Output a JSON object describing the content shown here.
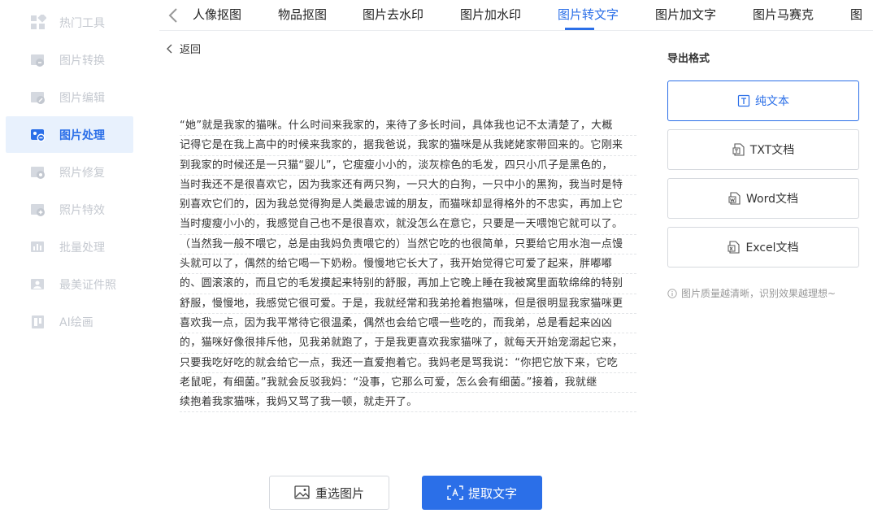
{
  "sidebar": {
    "items": [
      {
        "label": "热门工具",
        "icon": "grid-icon"
      },
      {
        "label": "图片转换",
        "icon": "image-convert-icon"
      },
      {
        "label": "图片编辑",
        "icon": "image-edit-icon"
      },
      {
        "label": "图片处理",
        "icon": "image-process-icon",
        "active": true
      },
      {
        "label": "照片修复",
        "icon": "photo-repair-icon"
      },
      {
        "label": "照片特效",
        "icon": "photo-effect-icon"
      },
      {
        "label": "批量处理",
        "icon": "batch-icon"
      },
      {
        "label": "最美证件照",
        "icon": "id-photo-icon"
      },
      {
        "label": "AI绘画",
        "icon": "ai-paint-icon"
      }
    ]
  },
  "tabs": [
    {
      "label": "人像抠图"
    },
    {
      "label": "物品抠图"
    },
    {
      "label": "图片去水印"
    },
    {
      "label": "图片加水印"
    },
    {
      "label": "图片转文字",
      "active": true
    },
    {
      "label": "图片加文字"
    },
    {
      "label": "图片马赛克"
    },
    {
      "label": "图"
    }
  ],
  "back_label": "返回",
  "text_lines": [
    "“她”就是我家的猫咪。什么时间来我家的，来待了多长时间，具体我也记不太清楚了，大概",
    "记得它是在我上高中的时候来我家的，据我爸说，我家的猫咪是从我姥姥家带回来的。它刚来",
    "到我家的时候还是一只猫“婴儿”，它瘦瘦小小的，淡灰棕色的毛发，四只小爪子是黑色的，",
    "当时我还不是很喜欢它，因为我家还有两只狗，一只大的白狗，一只中小的黑狗，我当时是特",
    "别喜欢它们的，因为我总觉得狗是人类最忠诚的朋友，而猫咪却显得格外的不忠实，再加上它",
    "当时瘦瘦小小的，我感觉自己也不是很喜欢，就没怎么在意它，只要是一天喂饱它就可以了。",
    "（当然我一般不喂它，总是由我妈负责喂它的）当然它吃的也很简单，只要给它用水泡一点馒",
    "头就可以了，偶然的给它喝一下奶粉。慢慢地它长大了，我开始觉得它可爱了起来，胖嘟嘟",
    "的、圆滚滚的，而且它的毛发摸起来特别的舒服，再加上它晚上睡在我被窝里面软绵绵的特别",
    "舒服，慢慢地，我感觉它很可爱。于是，我就经常和我弟抢着抱猫咪，但是很明显我家猫咪更",
    "喜欢我一点，因为我平常待它很温柔，偶然也会给它喂一些吃的，而我弟，总是看起来凶凶",
    "的，猫咪好像很排斥他，见我弟就跑了，于是我更喜欢我家猫咪了，就每天开始宠溺起它来，",
    "只要我吃好吃的就会给它一点，我还一直爱抱着它。我妈老是骂我说：“你把它放下来，它吃",
    "老鼠呢，有细菌。”我就会反驳我妈：“没事，它那么可爱，怎么会有细菌。”接着，我就继",
    "续抱着我家猫咪，我妈又骂了我一顿，就走开了。"
  ],
  "export": {
    "title": "导出格式",
    "formats": [
      {
        "label": "纯文本",
        "icon": "text-icon",
        "active": true
      },
      {
        "label": "TXT文档",
        "icon": "txt-file-icon"
      },
      {
        "label": "Word文档",
        "icon": "word-file-icon"
      },
      {
        "label": "Excel文档",
        "icon": "excel-file-icon"
      }
    ],
    "hint": "图片质量越清晰，识别效果越理想~"
  },
  "buttons": {
    "reselect": "重选图片",
    "extract": "提取文字"
  },
  "colors": {
    "accent": "#2b6fe8",
    "sidebar_active_bg": "#e8f1fd",
    "muted": "#c5c9d0"
  }
}
